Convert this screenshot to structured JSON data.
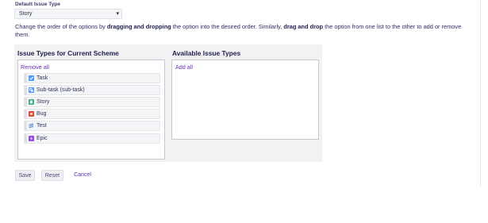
{
  "default_issue_type": {
    "label": "Default Issue Type",
    "selected": "Story"
  },
  "help": {
    "part1": "Change the order of the options by ",
    "bold1": "dragging and dropping",
    "part2": " the option into the desired order. Similarly, ",
    "bold2": "drag and drop",
    "part3": " the option from one list to the other to add or remove them."
  },
  "current_scheme": {
    "heading": "Issue Types for Current Scheme",
    "remove_all": "Remove all",
    "items": [
      {
        "label": "Task",
        "icon": "task-icon",
        "color": "#4c9aff"
      },
      {
        "label": "Sub-task (sub-task)",
        "icon": "subtask-icon",
        "color": "#4c9aff"
      },
      {
        "label": "Story",
        "icon": "story-icon",
        "color": "#36b37e"
      },
      {
        "label": "Bug",
        "icon": "bug-icon",
        "color": "#e5493a"
      },
      {
        "label": "Test",
        "icon": "test-icon",
        "color": "#3b82d6"
      },
      {
        "label": "Epic",
        "icon": "epic-icon",
        "color": "#904ee2"
      }
    ]
  },
  "available": {
    "heading": "Available Issue Types",
    "add_all": "Add all"
  },
  "actions": {
    "save": "Save",
    "reset": "Reset",
    "cancel": "Cancel"
  }
}
